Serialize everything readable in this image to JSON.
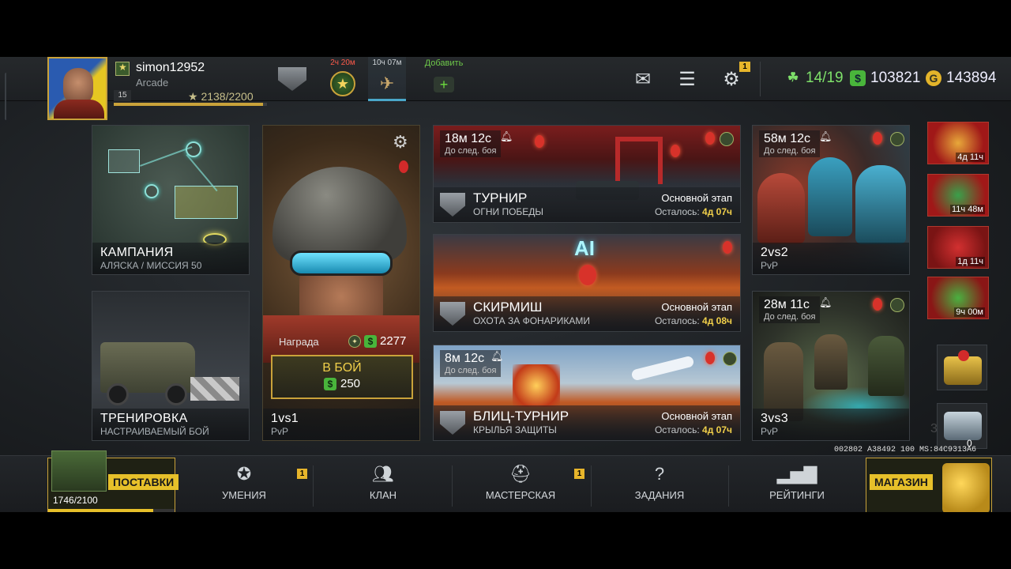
{
  "player": {
    "name": "simon12952",
    "mode": "Arcade",
    "level": "15",
    "xp": "2138/2200",
    "xp_fraction": 0.972
  },
  "topbar": {
    "event1_timer": "2ч 20м",
    "event2_timer": "10ч 07м",
    "add_label": "Добавить",
    "settings_badge": "1",
    "fuel": "14/19",
    "cash": "103821",
    "gold": "143894"
  },
  "cards": {
    "campaign": {
      "title": "КАМПАНИЯ",
      "sub": "АЛЯСКА / МИССИЯ 50"
    },
    "training": {
      "title": "ТРЕНИРОВКА",
      "sub": "НАСТРАИВАЕМЫЙ БОЙ"
    },
    "pvp1": {
      "reward_label": "Награда",
      "reward_value": "2277",
      "button_label": "В БОЙ",
      "cost": "250",
      "title": "1vs1",
      "sub": "PvP"
    },
    "m2v2": {
      "timer": "58м 12с",
      "timer_sub": "До след. боя",
      "title": "2vs2",
      "sub": "PvP"
    },
    "m3v3": {
      "timer": "28м 11с",
      "timer_sub": "До след. боя",
      "title": "3vs3",
      "sub": "PvP"
    }
  },
  "events": {
    "tournament": {
      "timer": "18м 12с",
      "timer_sub": "До след. боя",
      "title": "ТУРНИР",
      "sub": "ОГНИ ПОБЕДЫ",
      "stage": "Основной этап",
      "left_label": "Осталось:",
      "left_value": "4д 07ч"
    },
    "skirmish": {
      "title": "СКИРМИШ",
      "sub": "ОХОТА ЗА ФОНАРИКАМИ",
      "stage": "Основной этап",
      "left_label": "Осталось:",
      "left_value": "4д 08ч",
      "art_label": "AI"
    },
    "blitz": {
      "timer": "8м 12с",
      "timer_sub": "До след. боя",
      "title": "БЛИЦ-ТУРНИР",
      "sub": "КРЫЛЬЯ ЗАЩИТЫ",
      "stage": "Основной этап",
      "left_label": "Осталось:",
      "left_value": "4д 07ч"
    }
  },
  "side": {
    "item1_timer": "4д 11ч",
    "item2_timer": "11ч 48м",
    "item3_timer": "1д 11ч",
    "item4_timer": "9ч 00м",
    "chest_count": "0",
    "ghost_text": "3 ...bl"
  },
  "bottom": {
    "supply_label": "ПОСТАВКИ",
    "supply_count": "1746/2100",
    "supply_fraction": 0.831,
    "skills": "УМЕНИЯ",
    "skills_badge": "1",
    "clan": "КЛАН",
    "workshop": "МАСТЕРСКАЯ",
    "workshop_badge": "1",
    "tasks": "ЗАДАНИЯ",
    "ratings": "РЕЙТИНГИ",
    "shop_label": "МАГАЗИН"
  },
  "build_info": "002802 A38492 100 MS:84C9313A6",
  "icons": {
    "mail": "envelope-icon",
    "chat": "chat-icon",
    "settings": "gear-icon",
    "fuel": "fuel-icon",
    "cash": "dollar-icon",
    "gold": "gold-coin-icon"
  }
}
